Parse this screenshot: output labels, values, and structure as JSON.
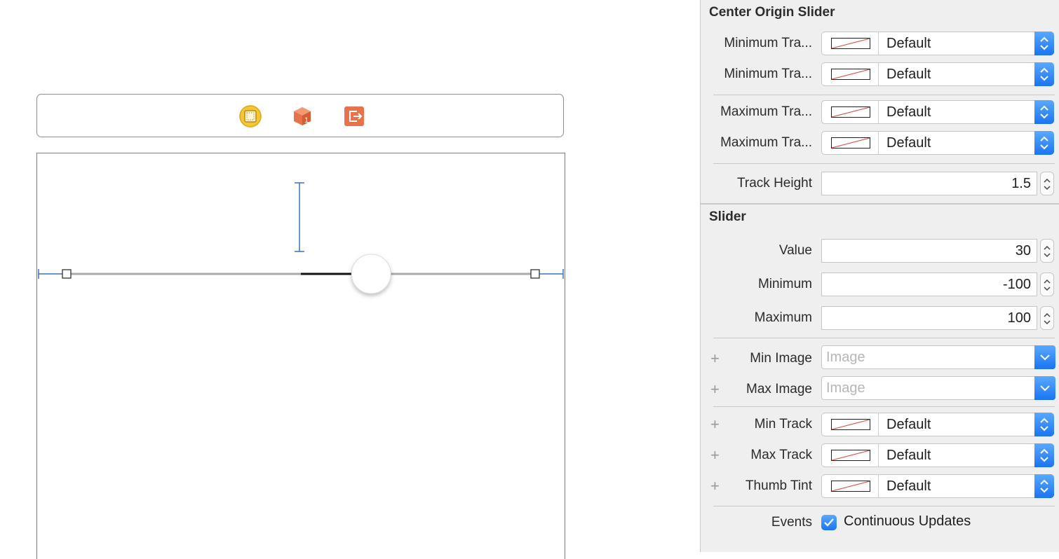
{
  "canvas": {
    "scene_bar_icons": [
      "view-controller-icon",
      "first-responder-icon",
      "exit-icon"
    ],
    "slider": {
      "value": 30,
      "minimum": -100,
      "maximum": 100
    }
  },
  "inspector": {
    "center_origin_slider": {
      "title": "Center Origin Slider",
      "rows": [
        {
          "label": "Minimum Tra...",
          "value": "Default"
        },
        {
          "label": "Minimum Tra...",
          "value": "Default"
        },
        {
          "label": "Maximum Tra...",
          "value": "Default"
        },
        {
          "label": "Maximum Tra...",
          "value": "Default"
        }
      ],
      "track_height": {
        "label": "Track Height",
        "value": "1.5"
      }
    },
    "slider": {
      "title": "Slider",
      "value": {
        "label": "Value",
        "value": "30"
      },
      "minimum": {
        "label": "Minimum",
        "value": "-100"
      },
      "maximum": {
        "label": "Maximum",
        "value": "100"
      },
      "min_image": {
        "label": "Min Image",
        "placeholder": "Image"
      },
      "max_image": {
        "label": "Max Image",
        "placeholder": "Image"
      },
      "min_track": {
        "label": "Min Track",
        "value": "Default"
      },
      "max_track": {
        "label": "Max Track",
        "value": "Default"
      },
      "thumb_tint": {
        "label": "Thumb Tint",
        "value": "Default"
      },
      "events": {
        "label": "Events",
        "option": "Continuous Updates",
        "checked": true
      }
    }
  },
  "colors": {
    "accent": "#1a74f2",
    "selection": "#3b73b9"
  }
}
